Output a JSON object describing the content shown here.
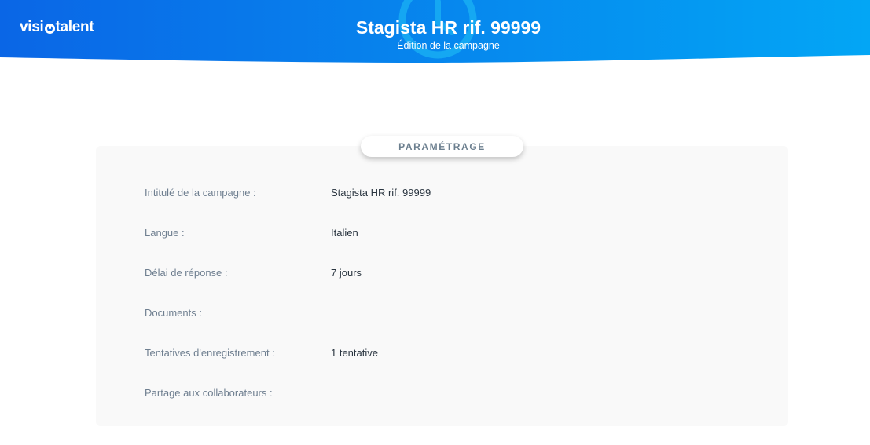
{
  "header": {
    "logo_left": "visi",
    "logo_right": "talent",
    "title": "Stagista HR rif. 99999",
    "subtitle": "Édition de la campagne",
    "gradient_start": "#0a66e6",
    "gradient_end": "#03a6f5"
  },
  "section": {
    "title": "PARAMÉTRAGE"
  },
  "fields": [
    {
      "label": "Intitulé de la campagne :",
      "value": "Stagista HR rif. 99999"
    },
    {
      "label": "Langue :",
      "value": "Italien"
    },
    {
      "label": "Délai de réponse :",
      "value": "7 jours"
    },
    {
      "label": "Documents :",
      "value": ""
    },
    {
      "label": "Tentatives d'enregistrement :",
      "value": "1 tentative"
    },
    {
      "label": "Partage aux collaborateurs :",
      "value": ""
    }
  ],
  "icons": {
    "logo_mark": "camera-ring-icon",
    "header_decoration": "clock-icon"
  }
}
